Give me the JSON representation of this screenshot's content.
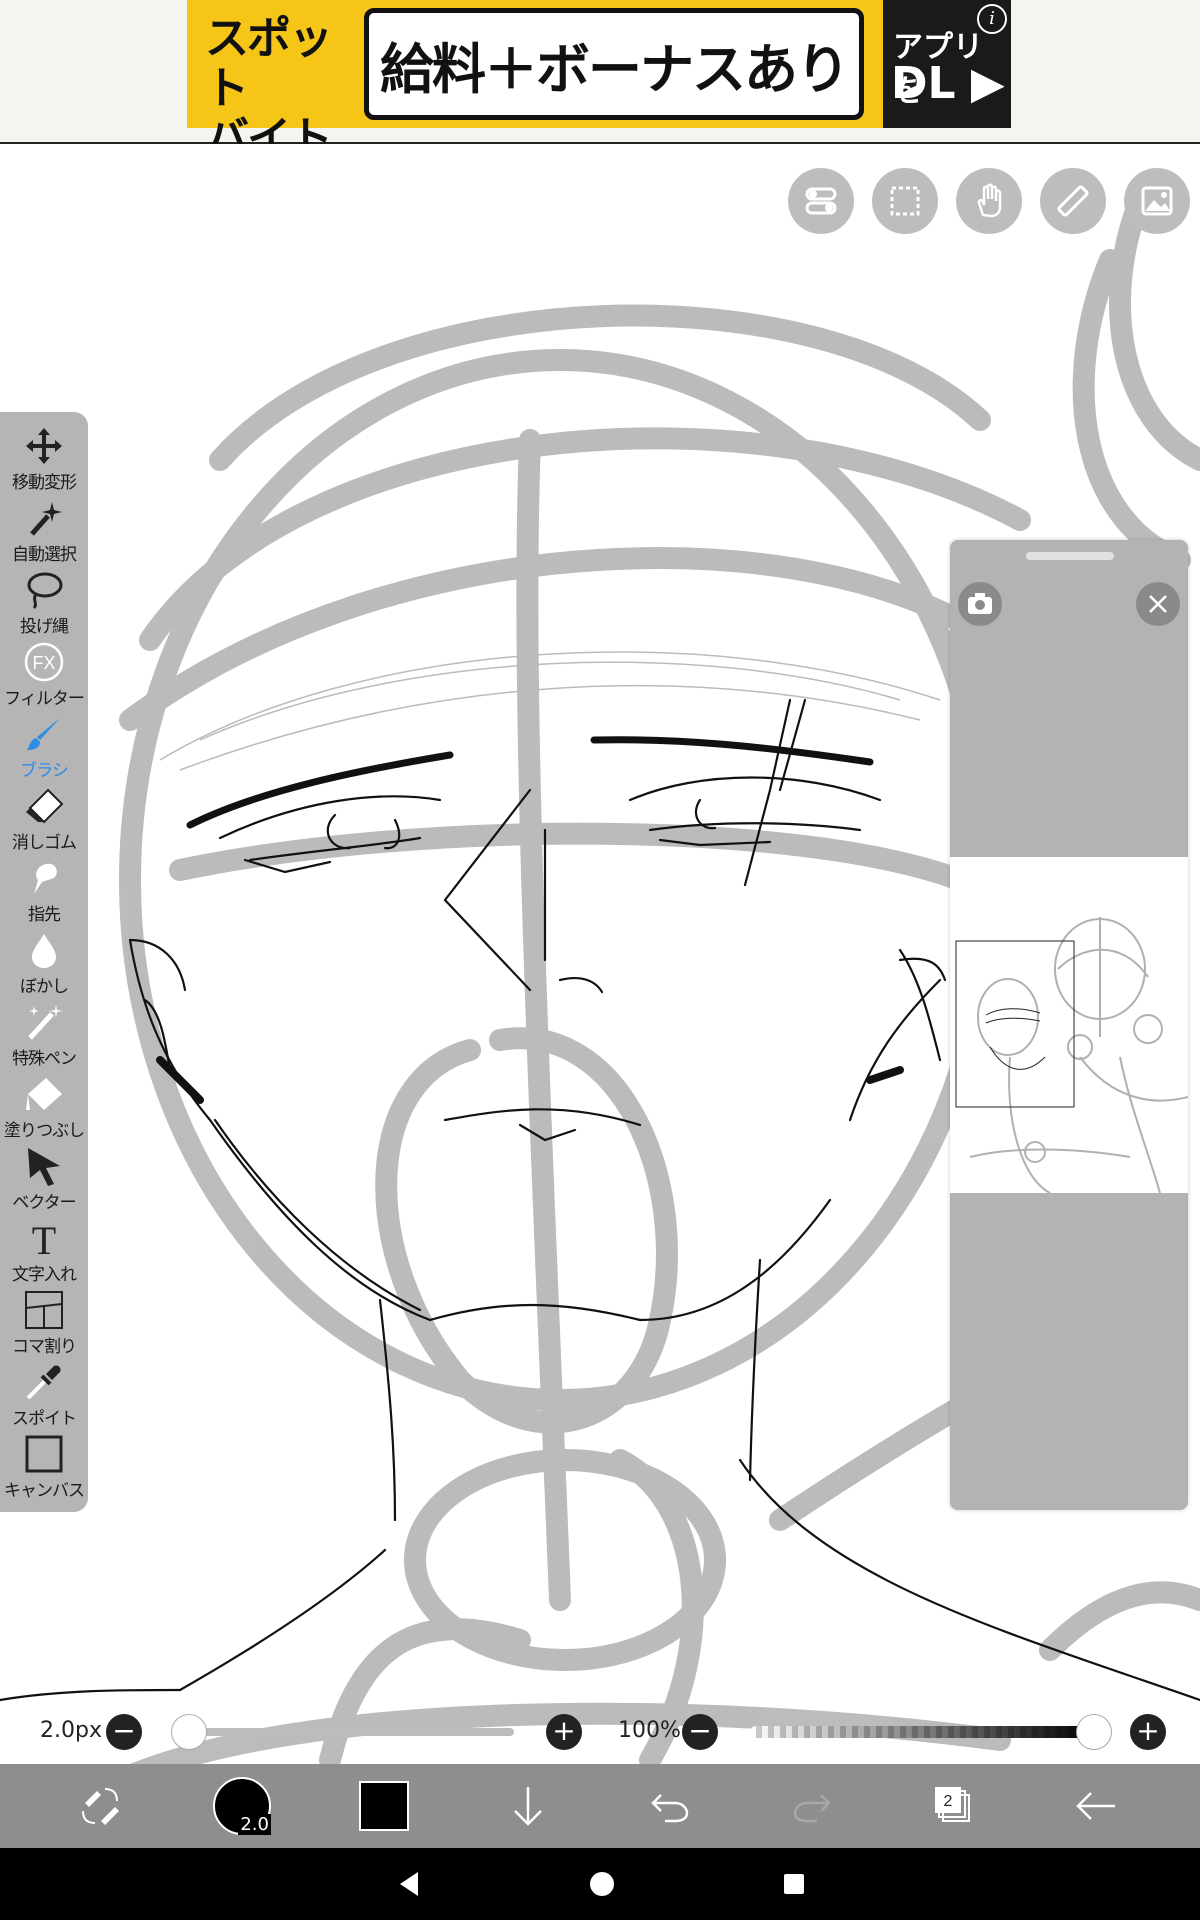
{
  "ad": {
    "brand": "スポット\nバイトル",
    "message": "給料＋ボーナスあり",
    "cta_line1": "アプリを",
    "cta_line2": "DL ▶",
    "info": "i"
  },
  "top_tools": [
    "toggle-icon",
    "selection-icon",
    "hand-icon",
    "ruler-icon",
    "image-icon"
  ],
  "toolbar": {
    "items": [
      {
        "label": "移動変形",
        "icon": "move-icon"
      },
      {
        "label": "自動選択",
        "icon": "magic-wand-icon"
      },
      {
        "label": "投げ縄",
        "icon": "lasso-icon"
      },
      {
        "label": "フィルター",
        "icon": "fx-icon"
      },
      {
        "label": "ブラシ",
        "icon": "brush-icon",
        "active": true
      },
      {
        "label": "消しゴム",
        "icon": "eraser-icon"
      },
      {
        "label": "指先",
        "icon": "finger-icon"
      },
      {
        "label": "ぼかし",
        "icon": "blur-icon"
      },
      {
        "label": "特殊ペン",
        "icon": "special-pen-icon"
      },
      {
        "label": "塗りつぶし",
        "icon": "fill-icon"
      },
      {
        "label": "ベクター",
        "icon": "vector-icon"
      },
      {
        "label": "文字入れ",
        "icon": "text-icon"
      },
      {
        "label": "コマ割り",
        "icon": "frame-icon"
      },
      {
        "label": "スポイト",
        "icon": "eyedropper-icon"
      },
      {
        "label": "キャンバス",
        "icon": "canvas-icon"
      }
    ],
    "fx_text": "FX",
    "text_tool_glyph": "T"
  },
  "sliders": {
    "brush_size": "2.0px",
    "opacity": "100%",
    "minus": "−",
    "plus": "+",
    "brush_size_fraction": 0.0,
    "opacity_fraction": 1.0
  },
  "bottom_bar": {
    "brush_size_badge": "2.0",
    "layer_count": "2",
    "color": "#000000"
  },
  "accent_color": "#2b8de6"
}
